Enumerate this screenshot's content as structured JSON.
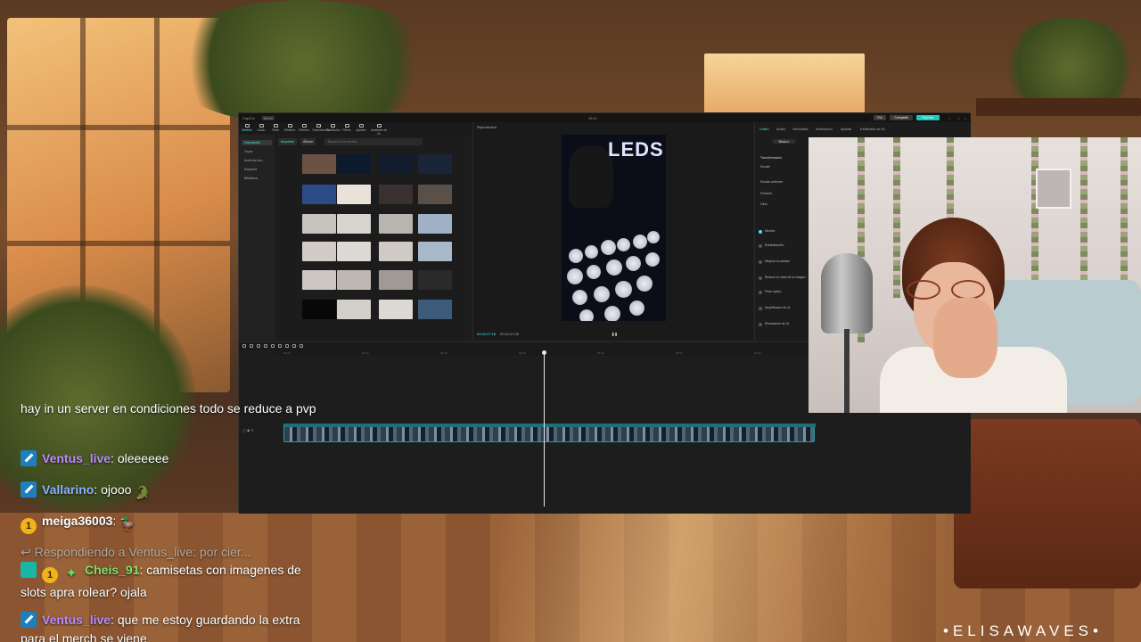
{
  "editor": {
    "title": "18:11",
    "app_name": "CapCut",
    "menu_label": "Menú",
    "pro_label": "Pro",
    "share_label": "Compartir",
    "export_label": "Exportar",
    "nav": [
      "Medios",
      "Audio",
      "Texto",
      "Stickers",
      "Efectos",
      "Transiciones",
      "Subtítulos",
      "Filtros",
      "Ajustes",
      "Avatares de IA"
    ],
    "left_items": [
      "Importación",
      "Tuyos",
      "Archivos bus...",
      "Espacios",
      "Biblioteca"
    ],
    "import_label": "Importar",
    "folder_label": "Álbum",
    "search_placeholder": "Busca en los medios",
    "player_header": "Reproductor",
    "timecode_current": "00:00:07:18",
    "timecode_total": "00:01:07:26",
    "video_overlay_text": "LEDS",
    "right_tabs": [
      "Vídeo",
      "Audio",
      "Velocidad",
      "Animación",
      "Ajustar",
      "Estilizado de IA"
    ],
    "right_subtab": "Básico",
    "right_sections": [
      "Transformación",
      "Escala",
      "Escala uniforme",
      "Posición",
      "Girar",
      "Mezcla",
      "Estabilización",
      "Mejorar la calidad",
      "Reducir el ruido de la imagen",
      "Paso óptico",
      "Amplificador de IA",
      "Eliminación de IA"
    ],
    "ruler_ticks": [
      "00:00",
      "00:10",
      "00:20",
      "00:30",
      "00:40",
      "00:50",
      "01:00",
      "01:10"
    ]
  },
  "chat": {
    "messages": [
      {
        "type": "plain",
        "text": "hay in un server en condiciones todo se reduce a pvp"
      },
      {
        "type": "user",
        "badges": [
          "mod"
        ],
        "user": "Ventus_live",
        "user_color": "#b98cff",
        "text": "oleeeeee"
      },
      {
        "type": "user",
        "badges": [
          "mod"
        ],
        "user": "Vallarino",
        "user_color": "#8fb0ff",
        "text": "ojooo",
        "emote": "🐊"
      },
      {
        "type": "user",
        "badges": [
          "coin"
        ],
        "coin": "1",
        "user": "meiga36003",
        "user_color": "#ffffff",
        "text": "",
        "emote": "🦆"
      },
      {
        "type": "reply",
        "text": "Respondiendo a Ventus_live: por cier..."
      },
      {
        "type": "user",
        "badges": [
          "grid",
          "coin",
          "sparkle"
        ],
        "coin": "1",
        "user": "Cheis_91",
        "user_color": "#7ce26a",
        "text": "camisetas con imagenes de slots apra rolear? ojala"
      },
      {
        "type": "user",
        "badges": [
          "mod"
        ],
        "user": "Ventus_live",
        "user_color": "#b98cff",
        "text": "que me estoy guardando la extra para el merch se viene"
      }
    ]
  },
  "brand": "•ELISAWAVES•",
  "colors": {
    "accent": "#4ee3e8",
    "editor_bg": "#1e1e1f",
    "track_border": "#1fa0a8"
  }
}
